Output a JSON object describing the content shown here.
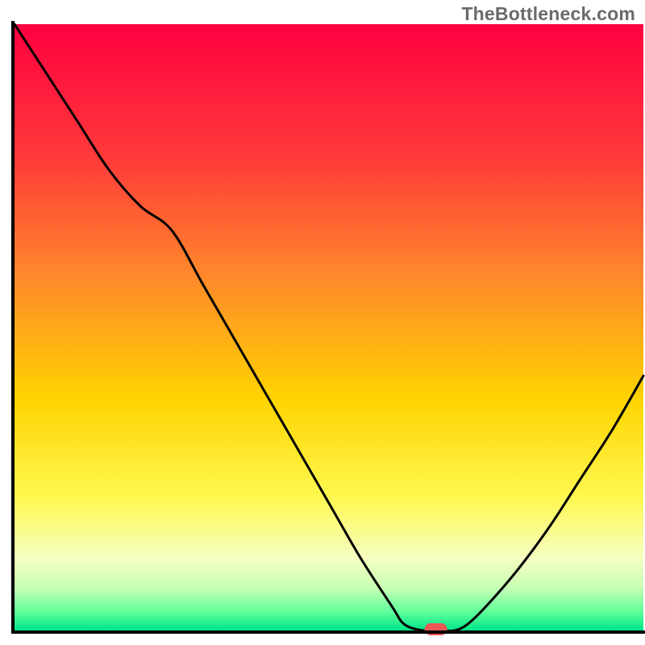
{
  "watermark": "TheBottleneck.com",
  "chart_data": {
    "type": "line",
    "title": "",
    "xlabel": "",
    "ylabel": "",
    "xlim": [
      0,
      100
    ],
    "ylim": [
      0,
      100
    ],
    "x": [
      0,
      5,
      10,
      15,
      20,
      25,
      30,
      35,
      40,
      45,
      50,
      55,
      60,
      62,
      65,
      68,
      70,
      72,
      75,
      80,
      85,
      90,
      95,
      100
    ],
    "values": [
      100,
      92,
      84,
      76,
      70,
      66,
      57,
      48,
      39,
      30,
      21,
      12,
      4,
      1,
      0,
      0,
      0,
      1,
      4,
      10,
      17,
      25,
      33,
      42
    ],
    "series": [
      {
        "name": "bottleneck-curve",
        "type": "line"
      }
    ],
    "marker": {
      "x": 67,
      "y": 0,
      "color": "#eb5757",
      "shape": "pill"
    },
    "background": {
      "type": "vertical-gradient",
      "stops": [
        {
          "pct": 0,
          "color": "#ff0040"
        },
        {
          "pct": 22,
          "color": "#ff3a3a"
        },
        {
          "pct": 42,
          "color": "#ff8a2a"
        },
        {
          "pct": 62,
          "color": "#ffd400"
        },
        {
          "pct": 78,
          "color": "#fff850"
        },
        {
          "pct": 88,
          "color": "#f6ffc0"
        },
        {
          "pct": 93,
          "color": "#c8ffb4"
        },
        {
          "pct": 97,
          "color": "#5cff9a"
        },
        {
          "pct": 100,
          "color": "#00e58a"
        }
      ]
    },
    "axes": {
      "color": "#000000",
      "width": 4
    }
  }
}
